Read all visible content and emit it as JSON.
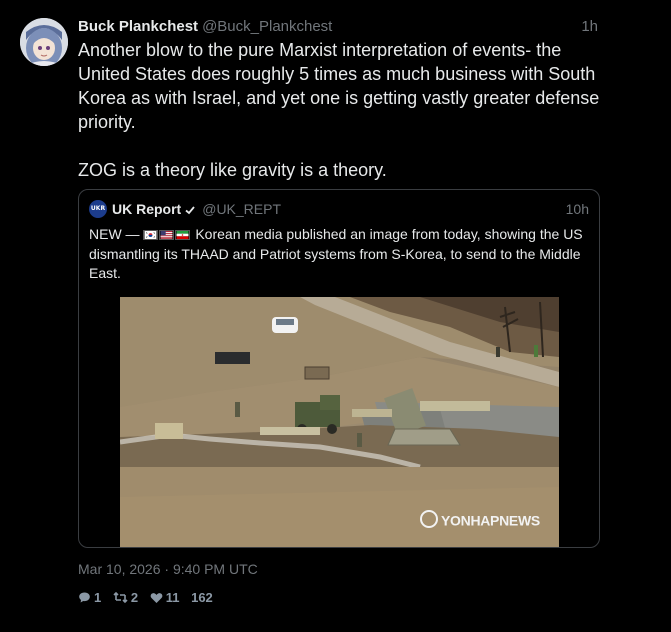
{
  "post": {
    "author": {
      "display_name": "Buck Plankchest",
      "handle": "@Buck_Plankchest",
      "avatar_icon": "anime-character-avatar"
    },
    "relative_time": "1h",
    "text": "Another blow to the pure Marxist interpretation of events- the United States does roughly 5 times as much business with South Korea as with Israel, and yet one is getting vastly greater defense priority.\n\nZOG is a theory like gravity is a theory.",
    "timestamp": "Mar 10, 2026 · 9:40 PM UTC"
  },
  "quoted_post": {
    "author": {
      "display_name": "UK Report",
      "handle": "@UK_REPT",
      "logo_text": "UKR",
      "verified_icon": "verified-check-icon"
    },
    "relative_time": "10h",
    "text_prefix": "NEW —",
    "flags": [
      "south-korea-flag",
      "usa-flag",
      "iran-flag"
    ],
    "text_body": " Korean media published an image from today, showing the US dismantling its THAAD and Patriot systems from S-Korea, to send to the Middle East.",
    "media": {
      "description_icon": "military-photo",
      "watermark": "YONHAPNEWS"
    }
  },
  "actions": {
    "replies": "1",
    "reposts": "2",
    "likes": "11",
    "views": "162",
    "reply_icon": "comment-icon",
    "repost_icon": "retweet-icon",
    "like_icon": "heart-icon"
  },
  "colors": {
    "background": "#000000",
    "text_primary": "#e7e9ea",
    "text_secondary": "#71767b",
    "border": "#3a3d41"
  }
}
